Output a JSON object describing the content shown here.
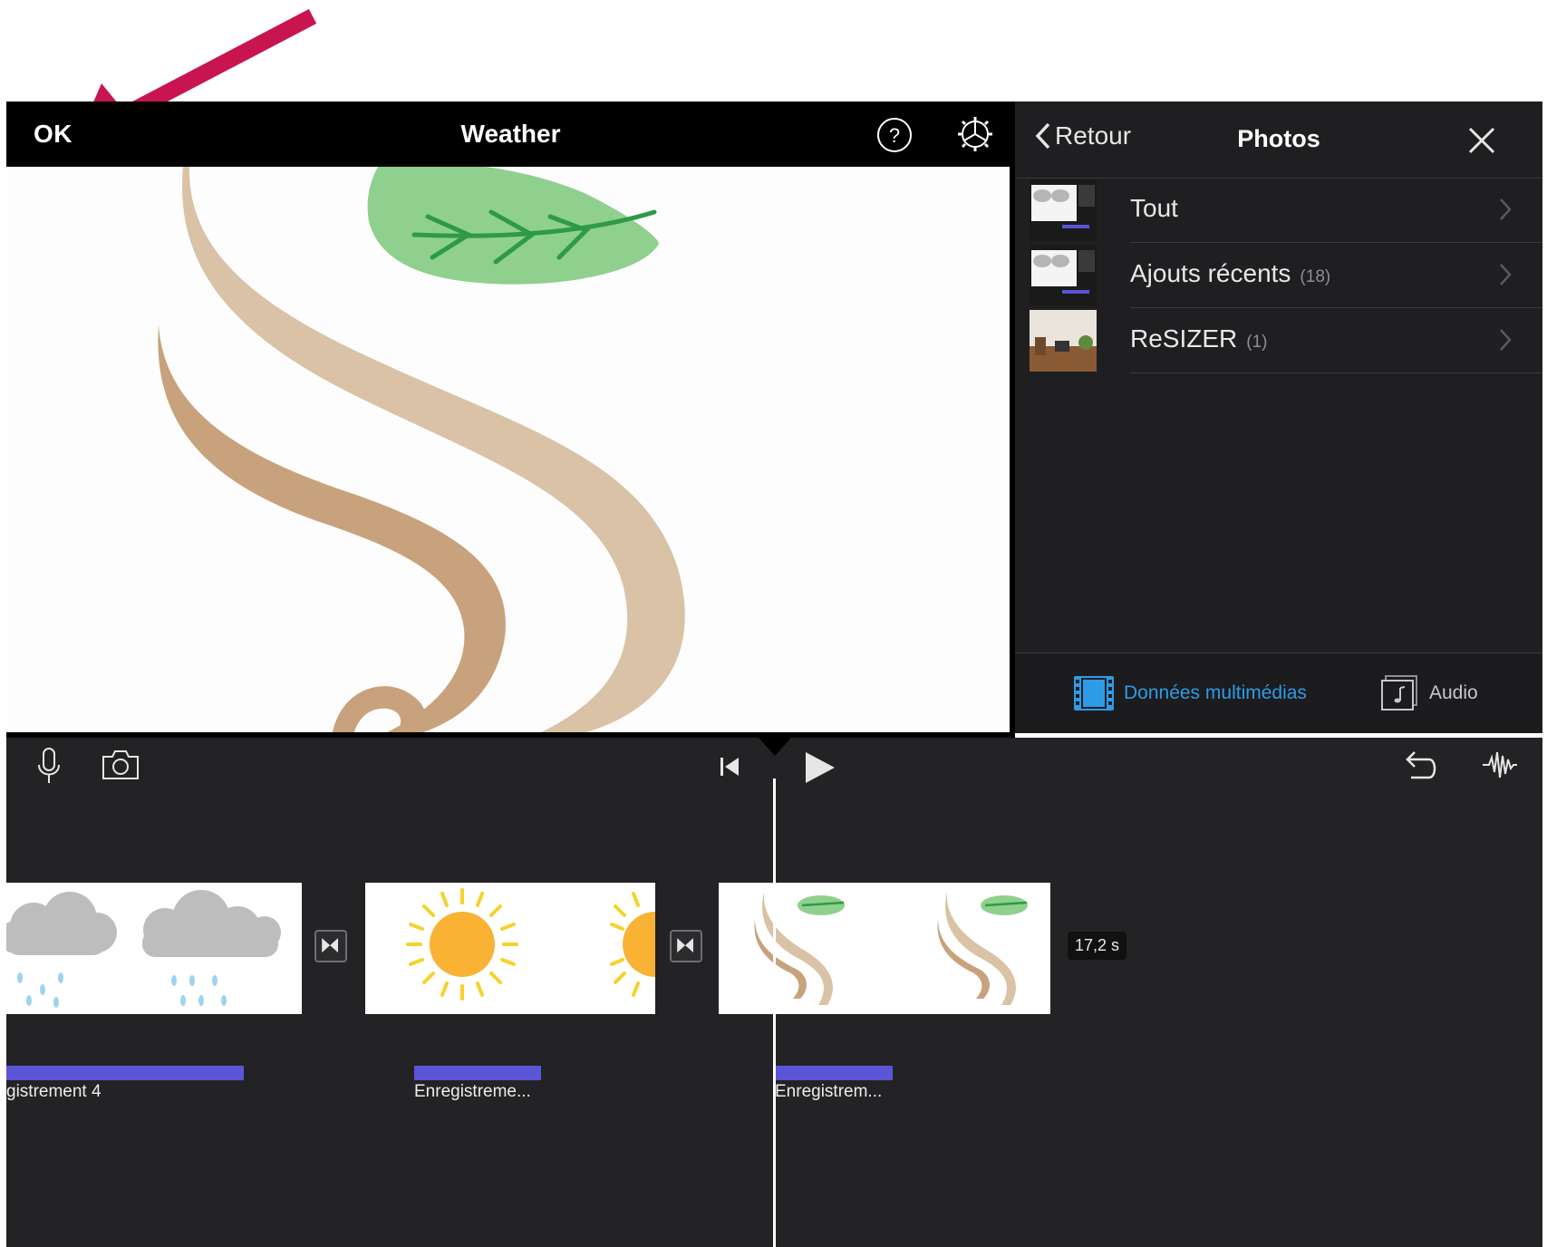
{
  "header": {
    "ok_label": "OK",
    "project_title": "Weather"
  },
  "browser": {
    "back_label": "Retour",
    "title": "Photos",
    "albums": [
      {
        "name": "Tout",
        "count": ""
      },
      {
        "name": "Ajouts récents",
        "count": "(18)"
      },
      {
        "name": "ReSIZER",
        "count": "(1)"
      }
    ],
    "tabs": {
      "media": "Données multimédias",
      "audio": "Audio"
    }
  },
  "timeline": {
    "duration": "17,2 s",
    "audio_clips": [
      "gistrement 4",
      "Enregistreme...",
      "Enregistrem..."
    ]
  },
  "colors": {
    "accent": "#2e9be6",
    "annotation_arrow": "#c8154f",
    "audio_clip": "#5a55d6",
    "timeline_bg": "#232325"
  }
}
